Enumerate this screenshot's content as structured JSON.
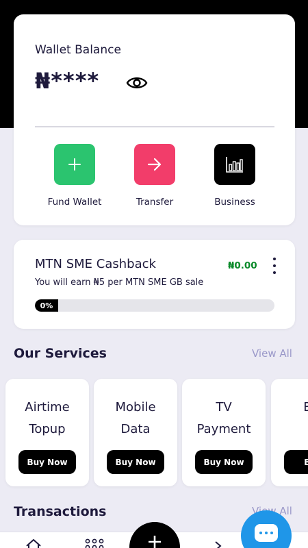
{
  "wallet": {
    "label": "Wallet Balance",
    "balance": "₦****",
    "toggle_icon": "eye-icon",
    "actions": [
      {
        "label": "Fund Wallet",
        "icon": "plus-icon",
        "color": "#2bc46f"
      },
      {
        "label": "Transfer",
        "icon": "arrow-right-icon",
        "color": "#f23d6a"
      },
      {
        "label": "Business",
        "icon": "bar-chart-icon",
        "color": "#000000"
      }
    ]
  },
  "cashback": {
    "title": "MTN SME Cashback",
    "amount": "₦0.00",
    "subtitle": "You will earn ₦5 per MTN SME GB sale",
    "progress_label": "0%",
    "progress_value": 0
  },
  "services": {
    "title": "Our Services",
    "view_all": "View All",
    "items": [
      {
        "line1": "Airtime",
        "line2": "Topup",
        "button": "Buy Now"
      },
      {
        "line1": "Mobile",
        "line2": "Data",
        "button": "Buy Now"
      },
      {
        "line1": "TV",
        "line2": "Payment",
        "button": "Buy Now"
      },
      {
        "line1": "Ele",
        "line2": "B",
        "button": "Buy"
      }
    ]
  },
  "transactions": {
    "title": "Transactions",
    "view_all": "View All"
  },
  "bottom_nav": {
    "items": [
      "home-icon",
      "grid-icon",
      "add-icon",
      "chevron-right-icon"
    ],
    "chat_icon": "chat-icon"
  },
  "colors": {
    "background": "#ecebf4",
    "accent_link": "#9a98c9",
    "positive": "#0b8a2a"
  }
}
